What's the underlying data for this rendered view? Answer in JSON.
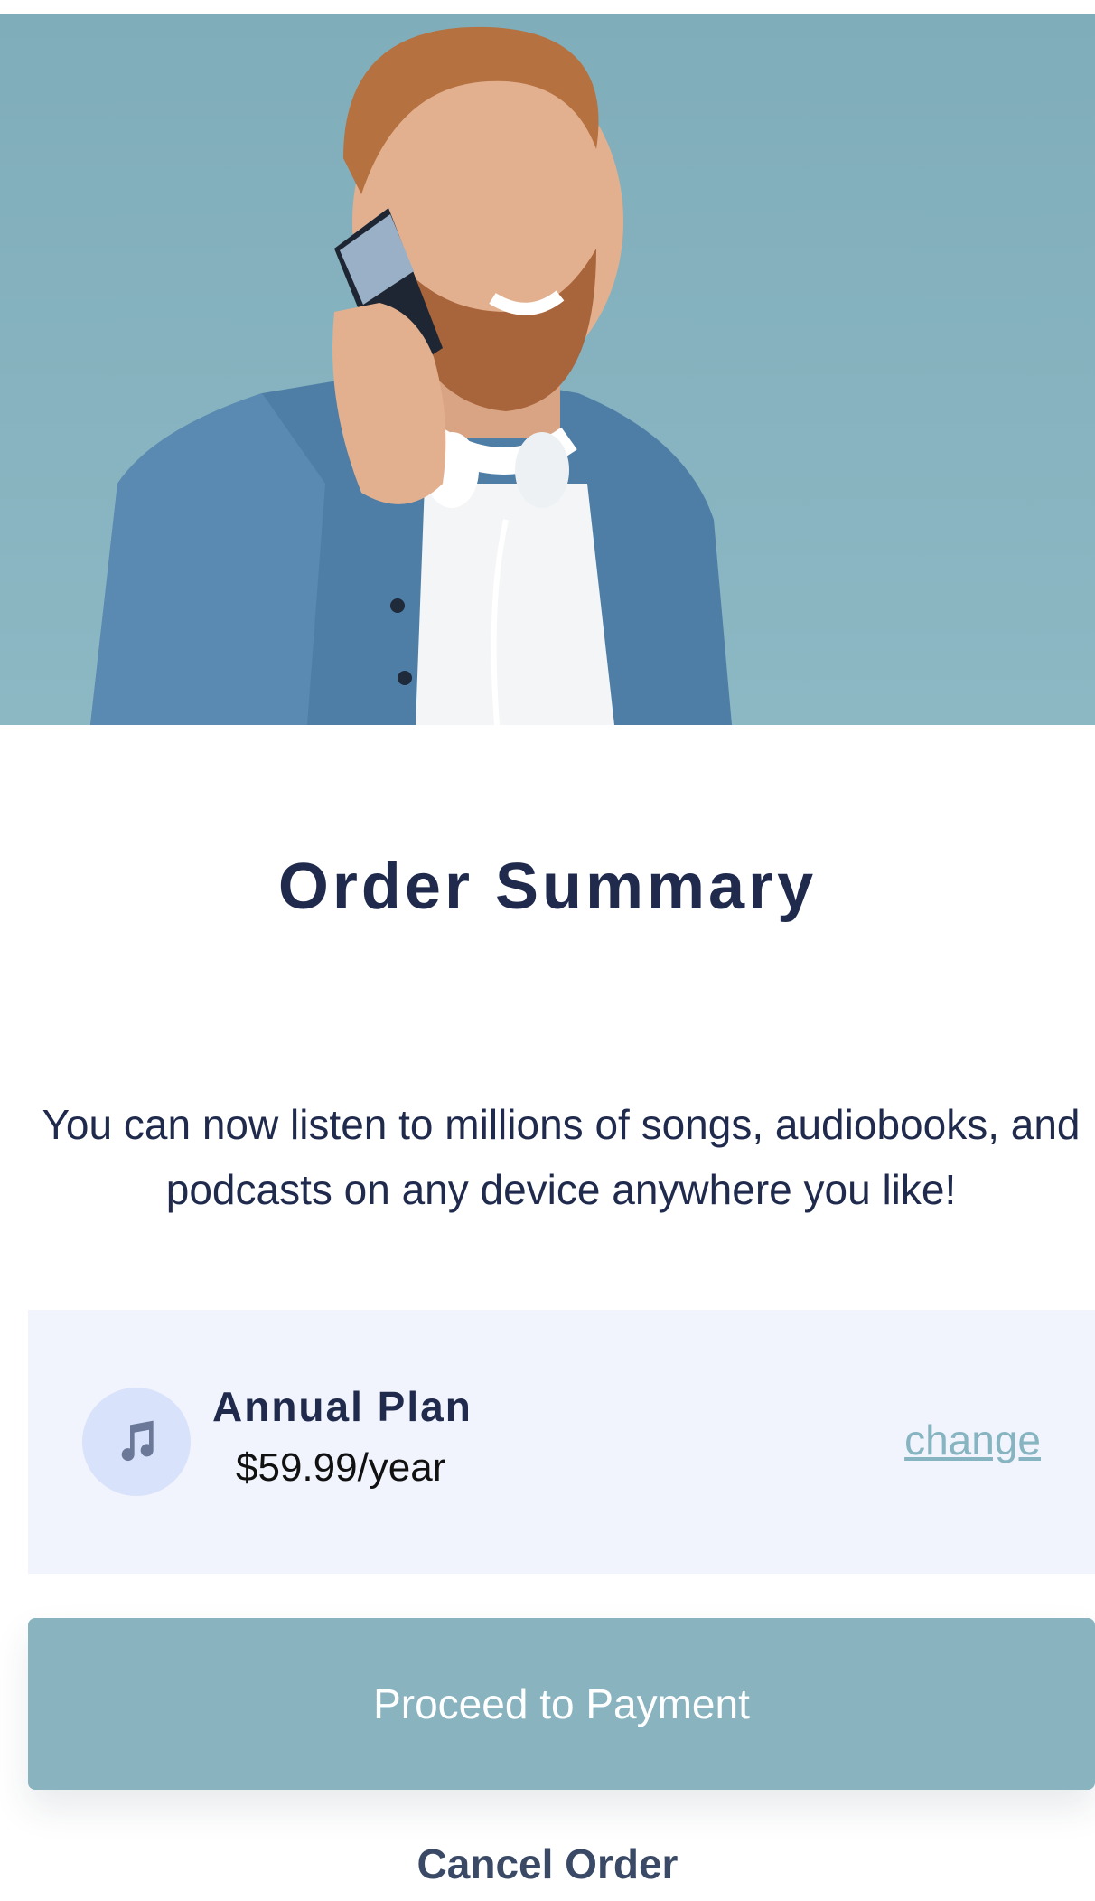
{
  "header": {
    "title": "Order Summary"
  },
  "intro": {
    "line1": "You can now listen to millions of songs, audiobooks, and",
    "line2": "podcasts on any device anywhere you like!"
  },
  "plan": {
    "icon": "music-note-icon",
    "name": "Annual Plan",
    "price": "$59.99/year",
    "change_label": "change"
  },
  "actions": {
    "proceed_label": "Proceed to Payment",
    "cancel_label": "Cancel Order"
  },
  "colors": {
    "primary_text": "#1f2a4d",
    "accent": "#88b3bf",
    "card_background": "#f1f4fd",
    "hero_background": "#86b4c0"
  }
}
